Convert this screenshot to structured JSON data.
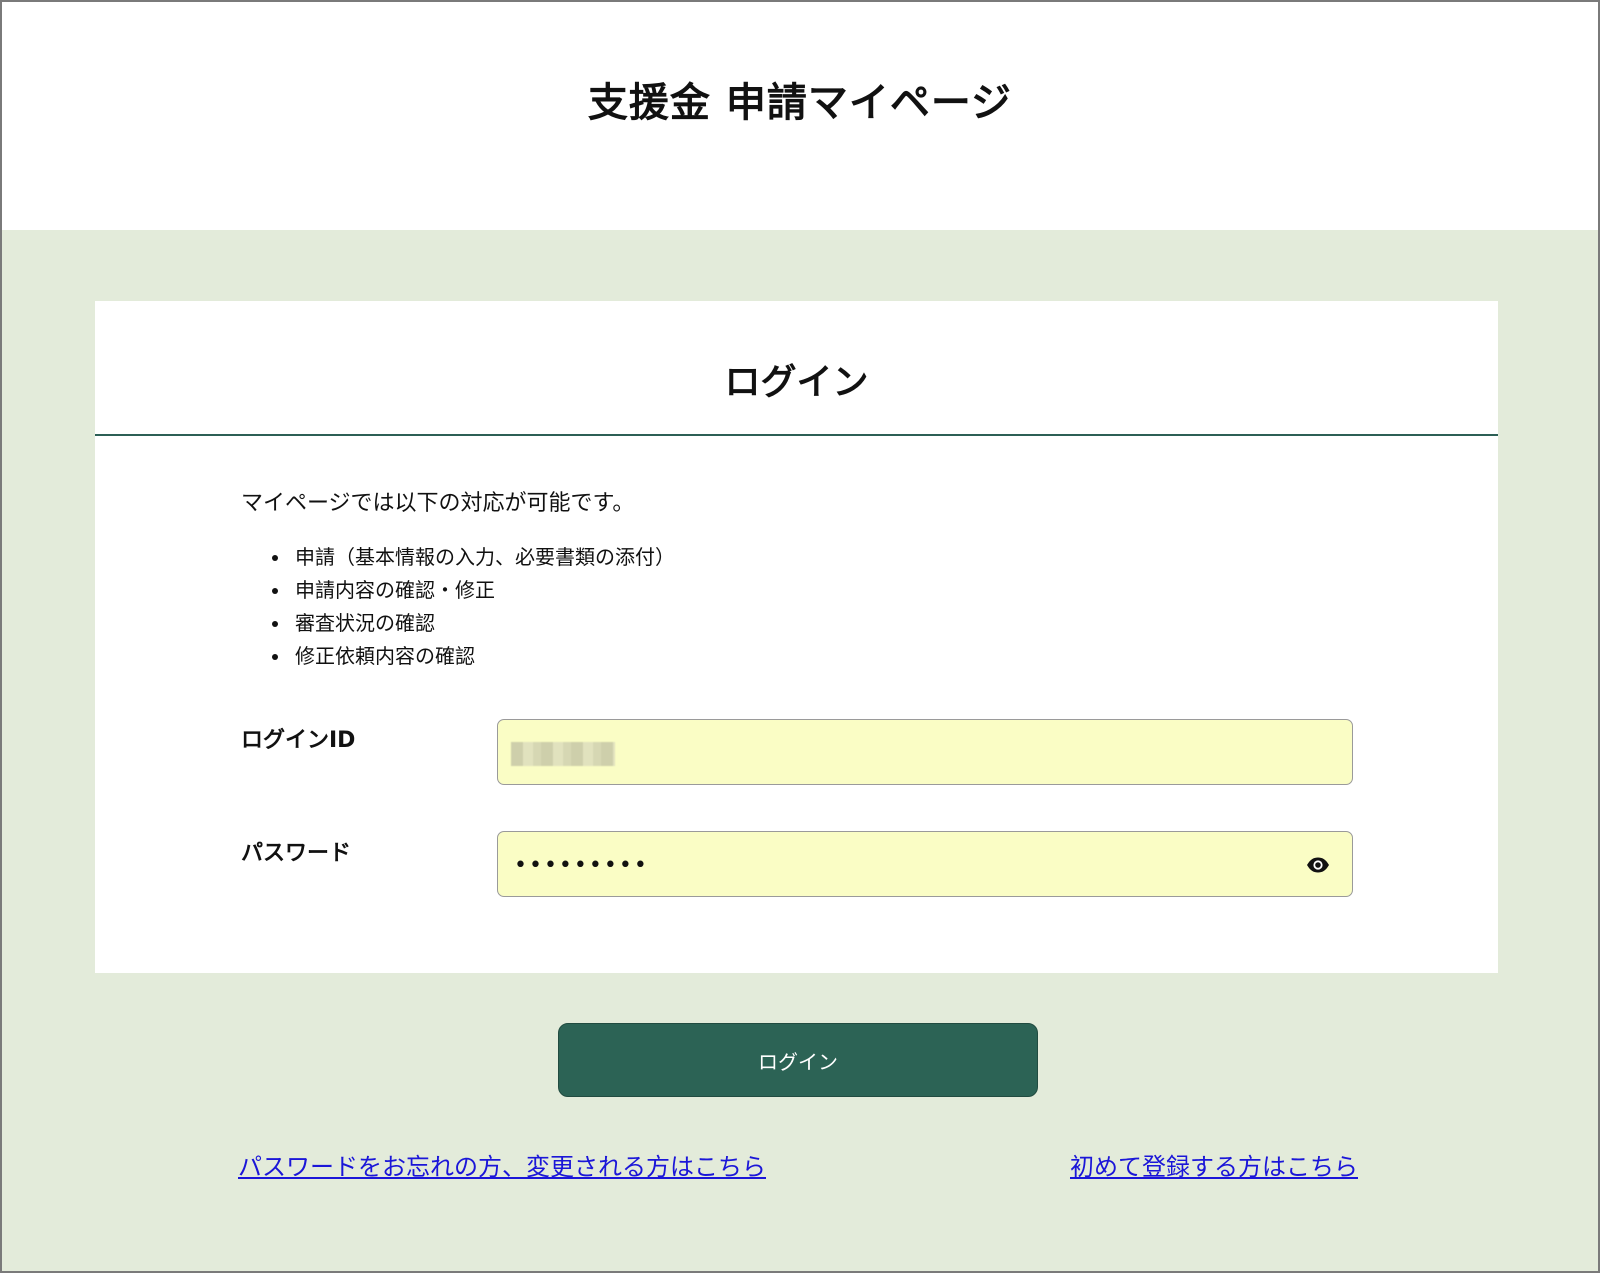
{
  "header": {
    "title": "支援金 申請マイページ"
  },
  "login": {
    "heading": "ログイン",
    "intro": "マイページでは以下の対応が可能です。",
    "features": [
      "申請（基本情報の入力、必要書類の添付）",
      "申請内容の確認・修正",
      "審査状況の確認",
      "修正依頼内容の確認"
    ],
    "id_label": "ログインID",
    "password_label": "パスワード",
    "password_value": "•••••••••",
    "password_toggle_icon": "eye-icon",
    "submit_label": "ログイン"
  },
  "links": {
    "forgot_password": "パスワードをお忘れの方、変更される方はこちら",
    "register": "初めて登録する方はこちら"
  },
  "colors": {
    "page_background": "#e3ebda",
    "accent": "#2c6355",
    "input_background": "#fafdc5",
    "link": "#1b16d8"
  }
}
